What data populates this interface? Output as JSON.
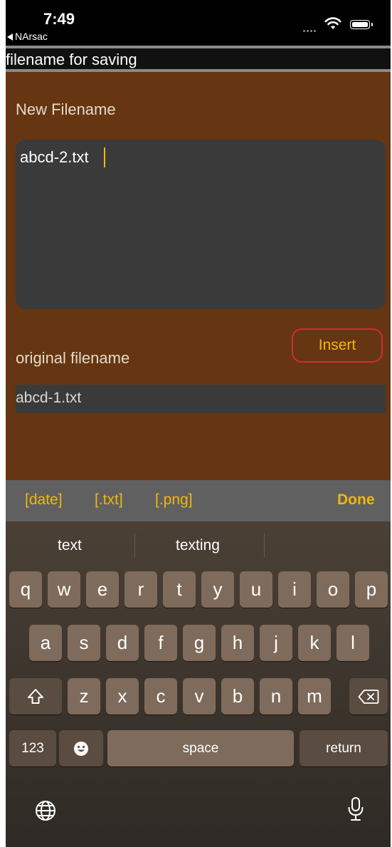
{
  "status_bar": {
    "time": "7:49",
    "back_app": "NArsac"
  },
  "header": {
    "title": "filename for saving"
  },
  "form": {
    "new_label": "New Filename",
    "new_value": "abcd-2.txt",
    "original_label": "original filename",
    "original_value": "abcd-1.txt",
    "insert_label": "Insert"
  },
  "toolbar": {
    "date": "[date]",
    "txt": "[.txt]",
    "png": "[.png]",
    "done": "Done"
  },
  "keyboard": {
    "suggestions": [
      "text",
      "texting"
    ],
    "row1": [
      "q",
      "w",
      "e",
      "r",
      "t",
      "y",
      "u",
      "i",
      "o",
      "p"
    ],
    "row2": [
      "a",
      "s",
      "d",
      "f",
      "g",
      "h",
      "j",
      "k",
      "l"
    ],
    "row3": [
      "z",
      "x",
      "c",
      "v",
      "b",
      "n",
      "m"
    ],
    "numbers_label": "123",
    "space_label": "space",
    "return_label": "return"
  },
  "colors": {
    "content_bg": "#653611",
    "accent_yellow": "#f0b70b",
    "insert_border": "#cf2c36",
    "field_bg": "#3a3a3a",
    "toolbar_bg": "#606060"
  }
}
